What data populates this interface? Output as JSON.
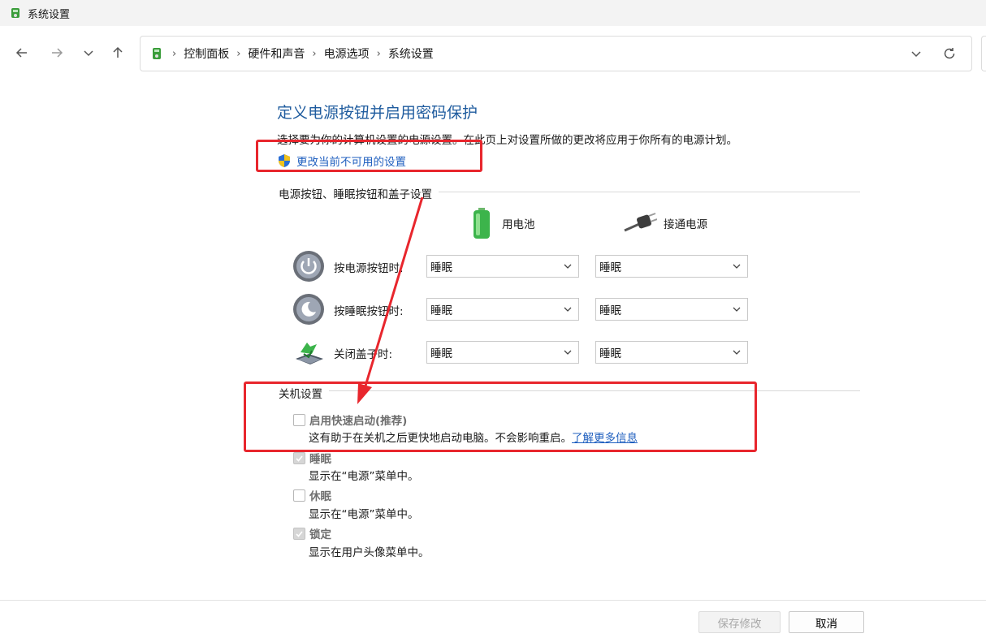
{
  "window": {
    "title": "系统设置"
  },
  "nav": {
    "breadcrumbs": [
      "控制面板",
      "硬件和声音",
      "电源选项",
      "系统设置"
    ]
  },
  "page": {
    "heading": "定义电源按钮并启用密码保护",
    "description": "选择要为你的计算机设置的电源设置。在此页上对设置所做的更改将应用于你所有的电源计划。",
    "change_link": "更改当前不可用的设置"
  },
  "buttons_section": {
    "title": "电源按钮、睡眠按钮和盖子设置",
    "col_battery": "用电池",
    "col_plugged": "接通电源",
    "rows": [
      {
        "label": "按电源按钮时:",
        "battery": "睡眠",
        "plugged": "睡眠"
      },
      {
        "label": "按睡眠按钮时:",
        "battery": "睡眠",
        "plugged": "睡眠"
      },
      {
        "label": "关闭盖子时:",
        "battery": "睡眠",
        "plugged": "睡眠"
      }
    ]
  },
  "shutdown_section": {
    "title": "关机设置",
    "options": [
      {
        "title": "启用快速启动(推荐)",
        "desc": "这有助于在关机之后更快地启动电脑。不会影响重启。",
        "link": "了解更多信息",
        "checked": false
      },
      {
        "title": "睡眠",
        "desc": "显示在“电源”菜单中。",
        "checked": true
      },
      {
        "title": "休眠",
        "desc": "显示在“电源”菜单中。",
        "checked": false
      },
      {
        "title": "锁定",
        "desc": "显示在用户头像菜单中。",
        "checked": true
      }
    ]
  },
  "footer": {
    "save": "保存修改",
    "cancel": "取消"
  },
  "colors": {
    "heading": "#1e5b9e",
    "link": "#1f5fbf",
    "annotation": "#e8262d"
  }
}
